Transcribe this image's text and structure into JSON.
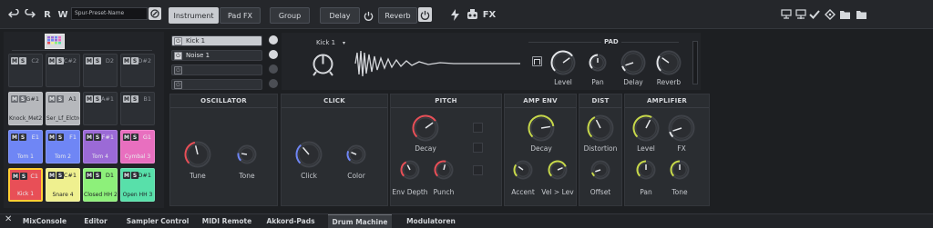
{
  "toolbar": {
    "undo": "undo-icon",
    "redo": "redo-icon",
    "read_label": "R",
    "write_label": "W",
    "preset_name": "Spur-Preset-Name",
    "instrument_label": "Instrument",
    "padfx_label": "Pad FX",
    "group_label": "Group",
    "delay_label": "Delay",
    "reverb_label": "Reverb",
    "fx_label": "FX"
  },
  "pads": [
    {
      "note": "C2",
      "name": "",
      "style": "empty"
    },
    {
      "note": "C#2",
      "name": "",
      "style": "empty"
    },
    {
      "note": "D2",
      "name": "",
      "style": "empty"
    },
    {
      "note": "D#2",
      "name": "",
      "style": "empty"
    },
    {
      "note": "G#1",
      "name": "Knock_Met2",
      "style": "gray"
    },
    {
      "note": "A1",
      "name": "Ser_Lf_Elctrc",
      "style": "gray"
    },
    {
      "note": "A#1",
      "name": "",
      "style": "empty"
    },
    {
      "note": "B1",
      "name": "",
      "style": "empty"
    },
    {
      "note": "E1",
      "name": "Tom 1",
      "style": "blue"
    },
    {
      "note": "F1",
      "name": "Tom 2",
      "style": "blue"
    },
    {
      "note": "F#1",
      "name": "Tom 4",
      "style": "purple"
    },
    {
      "note": "G1",
      "name": "Cymbal 3",
      "style": "pink"
    },
    {
      "note": "C1",
      "name": "Kick 1",
      "style": "red"
    },
    {
      "note": "C#1",
      "name": "Snare 4",
      "style": "yellow"
    },
    {
      "note": "D1",
      "name": "Closed HH 2",
      "style": "lgreen"
    },
    {
      "note": "D#1",
      "name": "Open HH 3",
      "style": "teal"
    }
  ],
  "pad_ms": {
    "m": "M",
    "s": "S"
  },
  "layers": [
    {
      "name": "Kick 1",
      "selected": true
    },
    {
      "name": "Noise 1",
      "selected": false
    },
    {
      "name": "",
      "selected": false
    },
    {
      "name": "",
      "selected": false
    }
  ],
  "sample": {
    "name": "Kick 1"
  },
  "pad_section": {
    "title": "PAD",
    "level": "Level",
    "pan": "Pan",
    "delay": "Delay",
    "reverb": "Reverb"
  },
  "sections": {
    "oscillator": {
      "title": "OSCILLATOR",
      "tune": "Tune",
      "tone": "Tone"
    },
    "click": {
      "title": "CLICK",
      "click": "Click",
      "color": "Color"
    },
    "pitch": {
      "title": "PITCH",
      "decay": "Decay",
      "env_depth": "Env Depth",
      "punch": "Punch"
    },
    "amp_env": {
      "title": "AMP ENV",
      "decay": "Decay",
      "accent": "Accent",
      "vel": "Vel > Lev"
    },
    "dist": {
      "title": "DIST",
      "distortion": "Distortion",
      "offset": "Offset"
    },
    "amplifier": {
      "title": "AMPLIFIER",
      "level": "Level",
      "fx": "FX",
      "pan": "Pan",
      "tone": "Tone"
    }
  },
  "tabs": [
    "MixConsole",
    "Editor",
    "Sampler Control",
    "MIDI Remote",
    "Akkord-Pads",
    "Drum Machine",
    "Modulatoren"
  ],
  "active_tab": "Drum Machine",
  "colors": {
    "accent_red": "#e84f57",
    "accent_yellow": "#c7d84a",
    "accent_blue": "#6f86f5"
  }
}
